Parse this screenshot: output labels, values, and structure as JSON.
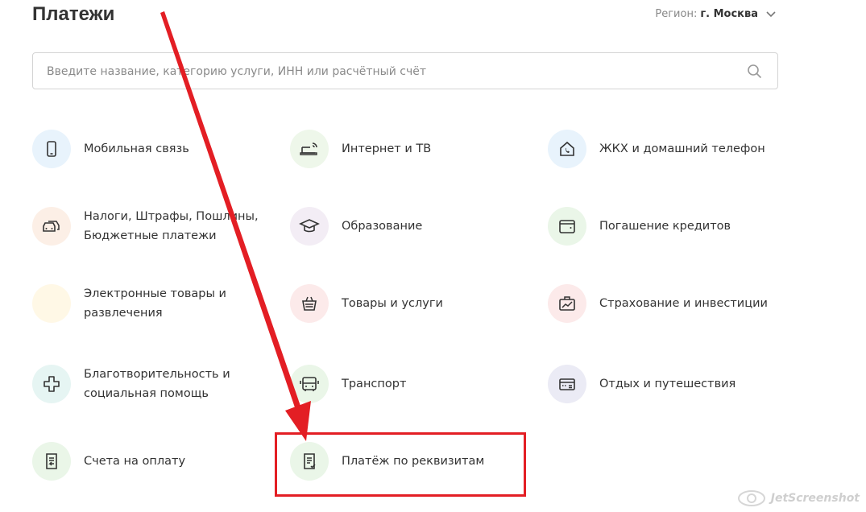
{
  "header": {
    "title": "Платежи",
    "region_label": "Регион:",
    "region_value": "г. Москва"
  },
  "search": {
    "placeholder": "Введите название, категорию услуги, ИНН или расчётный счёт",
    "value": ""
  },
  "categories": [
    {
      "label": "Мобильная связь",
      "icon": "smartphone-icon",
      "color": "#e8f3fc"
    },
    {
      "label": "Интернет и ТВ",
      "icon": "router-icon",
      "color": "#eef7ea"
    },
    {
      "label": "ЖКХ и домашний телефон",
      "icon": "house-phone-icon",
      "color": "#e8f3fc"
    },
    {
      "label": "Налоги, Штрафы, Пошлины,\nБюджетные платежи",
      "icon": "cars-icon",
      "color": "#fcefe6"
    },
    {
      "label": "Образование",
      "icon": "graduation-cap-icon",
      "color": "#f3edf5"
    },
    {
      "label": "Погашение кредитов",
      "icon": "wallet-icon",
      "color": "#eaf6e8"
    },
    {
      "label": "Электронные товары и\nразвлечения",
      "icon": "games-icon",
      "color": "#fff8e6"
    },
    {
      "label": "Товары и услуги",
      "icon": "basket-icon",
      "color": "#fceaea"
    },
    {
      "label": "Страхование и инвестиции",
      "icon": "briefcase-chart-icon",
      "color": "#fceaea"
    },
    {
      "label": "Благотворительность и\nсоциальная помощь",
      "icon": "cross-icon",
      "color": "#e6f5f3"
    },
    {
      "label": "Транспорт",
      "icon": "bus-icon",
      "color": "#eaf6e8"
    },
    {
      "label": "Отдых и путешествия",
      "icon": "ticket-icon",
      "color": "#ebebf5"
    },
    {
      "label": "Счета на оплату",
      "icon": "invoice-icon",
      "color": "#eaf6e8"
    },
    {
      "label": "Платёж по реквизитам",
      "icon": "document-check-icon",
      "color": "#eaf6e8"
    }
  ],
  "watermark": "JetScreenshot",
  "colors": {
    "accent": "#e31e24",
    "text": "#333333",
    "muted": "#8a8a8a"
  }
}
